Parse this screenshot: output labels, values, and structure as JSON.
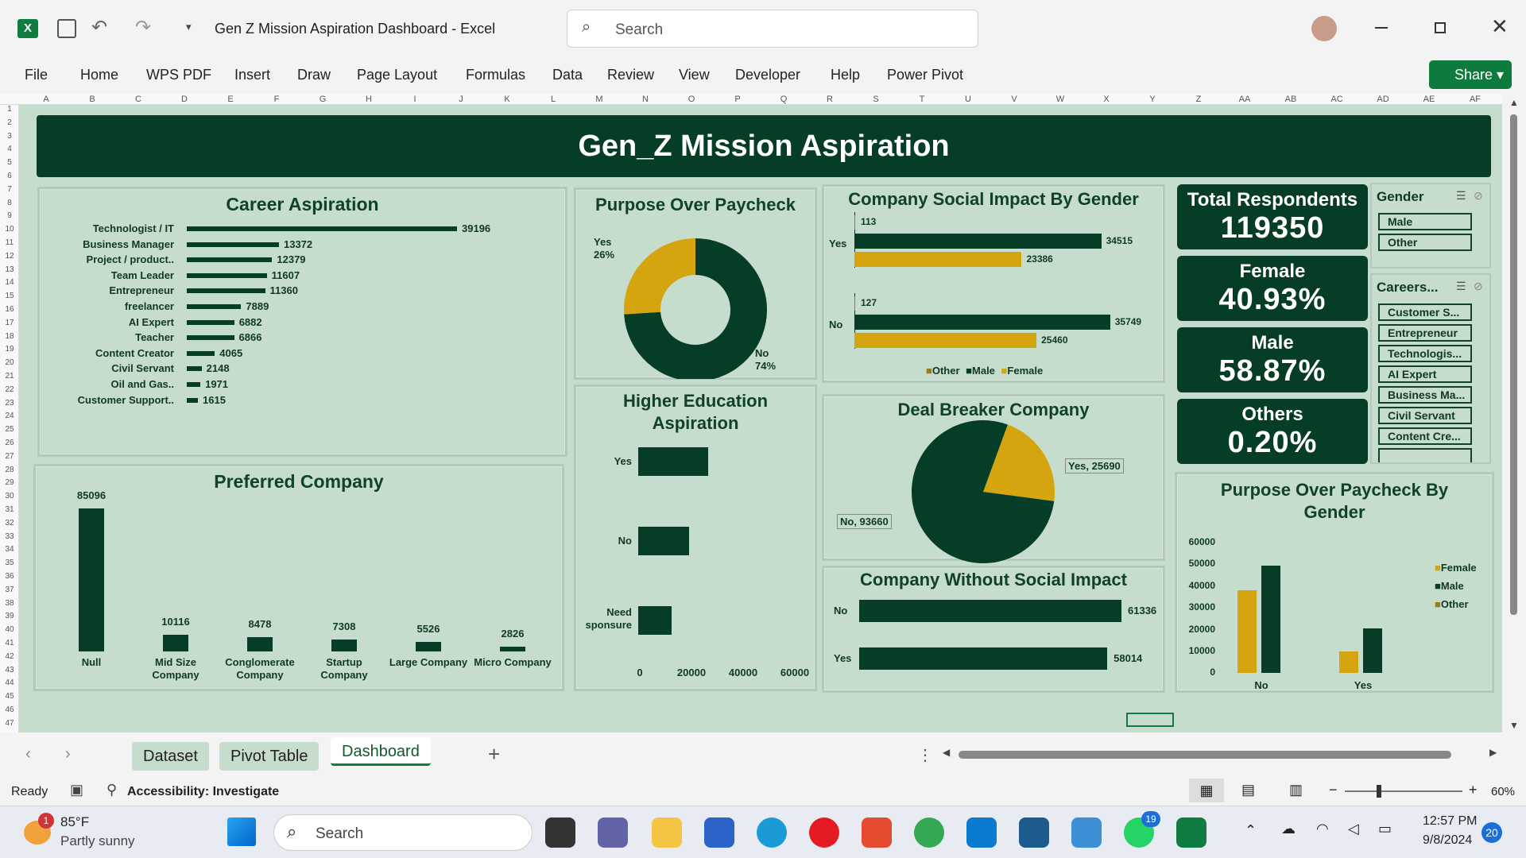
{
  "window": {
    "title": "Gen Z Mission Aspiration Dashboard  -  Excel",
    "search_placeholder": "Search"
  },
  "ribbon": {
    "tabs": [
      "File",
      "Home",
      "WPS PDF",
      "Insert",
      "Draw",
      "Page Layout",
      "Formulas",
      "Data",
      "Review",
      "View",
      "Developer",
      "Help",
      "Power Pivot"
    ],
    "share": "Share"
  },
  "columns": [
    "A",
    "B",
    "C",
    "D",
    "E",
    "F",
    "G",
    "H",
    "I",
    "J",
    "K",
    "L",
    "M",
    "N",
    "O",
    "P",
    "Q",
    "R",
    "S",
    "T",
    "U",
    "V",
    "W",
    "X",
    "Y",
    "Z",
    "AA",
    "AB",
    "AC",
    "AD",
    "AE",
    "AF"
  ],
  "rows": [
    "1",
    "2",
    "3",
    "4",
    "5",
    "6",
    "7",
    "8",
    "9",
    "10",
    "11",
    "12",
    "13",
    "14",
    "15",
    "16",
    "17",
    "18",
    "19",
    "20",
    "21",
    "22",
    "23",
    "24",
    "25",
    "26",
    "27",
    "28",
    "29",
    "30",
    "31",
    "32",
    "33",
    "34",
    "35",
    "36",
    "37",
    "38",
    "39",
    "40",
    "41",
    "42",
    "43",
    "44",
    "45",
    "46",
    "47"
  ],
  "dashboard": {
    "title": "Gen_Z Mission Aspiration"
  },
  "career": {
    "title": "Career Aspiration",
    "items": [
      {
        "label": "Technologist / IT",
        "value": 39196
      },
      {
        "label": "Business Manager",
        "value": 13372
      },
      {
        "label": "Project / product..",
        "value": 12379
      },
      {
        "label": "Team Leader",
        "value": 11607
      },
      {
        "label": "Entrepreneur",
        "value": 11360
      },
      {
        "label": "freelancer",
        "value": 7889
      },
      {
        "label": "AI Expert",
        "value": 6882
      },
      {
        "label": "Teacher",
        "value": 6866
      },
      {
        "label": "Content Creator",
        "value": 4065
      },
      {
        "label": "Civil Servant",
        "value": 2148
      },
      {
        "label": "Oil and Gas..",
        "value": 1971
      },
      {
        "label": "Customer Support..",
        "value": 1615
      }
    ]
  },
  "purpose": {
    "title": "Purpose Over Paycheck",
    "yes_label": "Yes",
    "yes_pct": "26%",
    "no_label": "No",
    "no_pct": "74%",
    "yes_value": 26,
    "no_value": 74
  },
  "social_gender": {
    "title": "Company Social Impact By Gender",
    "groups": [
      {
        "label": "Yes",
        "other": 113,
        "male": 34515,
        "female": 23386
      },
      {
        "label": "No",
        "other": 127,
        "male": 35749,
        "female": 25460
      }
    ],
    "legend": [
      "Other",
      "Male",
      "Female"
    ]
  },
  "kpis": {
    "total": {
      "label": "Total Respondents",
      "value": "119350"
    },
    "female": {
      "label": "Female",
      "value": "40.93%"
    },
    "male": {
      "label": "Male",
      "value": "58.87%"
    },
    "others": {
      "label": "Others",
      "value": "0.20%"
    }
  },
  "slicer_gender": {
    "title": "Gender",
    "items": [
      "Male",
      "Other"
    ]
  },
  "slicer_careers": {
    "title": "Careers...",
    "items": [
      "Customer S...",
      "Entrepreneur",
      "Technologis...",
      "AI Expert",
      "Business Ma...",
      "Civil Servant",
      "Content Cre..."
    ]
  },
  "preferred": {
    "title": "Preferred Company",
    "items": [
      {
        "label": "Null",
        "value": 85096
      },
      {
        "label": "Mid Size Company",
        "value": 10116
      },
      {
        "label": "Conglomerate Company",
        "value": 8478
      },
      {
        "label": "Startup Company",
        "value": 7308
      },
      {
        "label": "Large Company",
        "value": 5526
      },
      {
        "label": "Micro Company",
        "value": 2826
      }
    ]
  },
  "higher_ed": {
    "title": "Higher Education Aspiration",
    "items": [
      {
        "label": "Yes",
        "value": 27000
      },
      {
        "label": "No",
        "value": 19500
      },
      {
        "label": "Need sponsure",
        "value": 13000
      }
    ],
    "ticks": [
      "0",
      "20000",
      "40000",
      "60000"
    ]
  },
  "deal_breaker": {
    "title": "Deal Breaker Company",
    "yes_label": "Yes, 25690",
    "no_label": "No, 93660",
    "yes": 25690,
    "no": 93660
  },
  "without_impact": {
    "title": "Company Without Social Impact",
    "items": [
      {
        "label": "No",
        "value": 61336
      },
      {
        "label": "Yes",
        "value": 58014
      }
    ]
  },
  "purpose_gender": {
    "title": "Purpose Over Paycheck By Gender",
    "yticks": [
      "60000",
      "50000",
      "40000",
      "30000",
      "20000",
      "10000",
      "0"
    ],
    "groups": [
      {
        "label": "No",
        "female": 38000,
        "male": 49500,
        "other": 100
      },
      {
        "label": "Yes",
        "female": 10000,
        "male": 20500,
        "other": 100
      }
    ],
    "legend": [
      "Female",
      "Male",
      "Other"
    ]
  },
  "sheet_tabs": [
    "Dataset",
    "Pivot Table",
    "Dashboard"
  ],
  "status": {
    "ready": "Ready",
    "accessibility": "Accessibility: Investigate",
    "zoom": "60%"
  },
  "taskbar": {
    "temp": "85°F",
    "weather": "Partly sunny",
    "search": "Search",
    "time": "12:57 PM",
    "date": "9/8/2024",
    "badge_weather": "1",
    "badge_whatsapp": "19",
    "badge_notif": "20"
  },
  "colors": {
    "dark": "#063d26",
    "gold": "#d4a50e",
    "bg": "#c6dccd"
  }
}
